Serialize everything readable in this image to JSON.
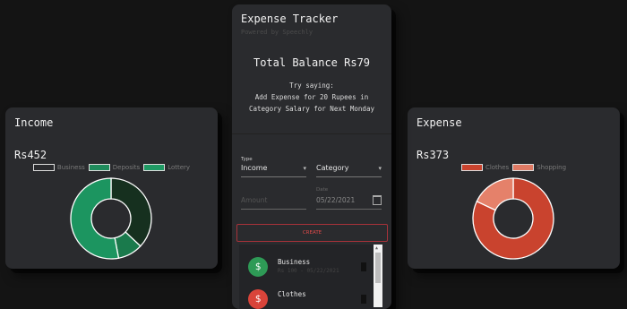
{
  "income": {
    "title": "Income",
    "total": "Rs452",
    "legend": [
      {
        "label": "Business",
        "color": "#2a2b2e"
      },
      {
        "label": "Deposits",
        "color": "#1f8c5c"
      },
      {
        "label": "Lottery",
        "color": "#1f9a64"
      }
    ],
    "chart_data": {
      "type": "pie",
      "categories": [
        "Business",
        "Deposits",
        "Lottery"
      ],
      "values": [
        37,
        10,
        53
      ],
      "colors": [
        "#16301f",
        "#1a7a4c",
        "#1c9560"
      ]
    }
  },
  "expense": {
    "title": "Expense",
    "total": "Rs373",
    "legend": [
      {
        "label": "Clothes",
        "color": "#c9432e"
      },
      {
        "label": "Shopping",
        "color": "#e07a64"
      }
    ],
    "chart_data": {
      "type": "pie",
      "categories": [
        "Clothes",
        "Shopping"
      ],
      "values": [
        82,
        18
      ],
      "colors": [
        "#c9432e",
        "#e5816a"
      ]
    }
  },
  "tracker": {
    "title": "Expense Tracker",
    "subtitle": "Powered by Speechly",
    "balance": "Total Balance Rs79",
    "hint": "Try saying:\nAdd Expense for 20 Rupees in Category Salary for Next Monday",
    "type_label": "Type",
    "type_value": "Income",
    "category_value": "Category",
    "amount_placeholder": "Amount",
    "date_label": "Date",
    "date_value": "05/22/2021",
    "create_label": "CREATE",
    "transactions": [
      {
        "name": "Business",
        "date": "Rs 100 - 05/22/2021",
        "icon": "$",
        "color": "#2e9a56"
      },
      {
        "name": "Clothes",
        "date": "",
        "icon": "$",
        "color": "#d9443a"
      }
    ]
  }
}
